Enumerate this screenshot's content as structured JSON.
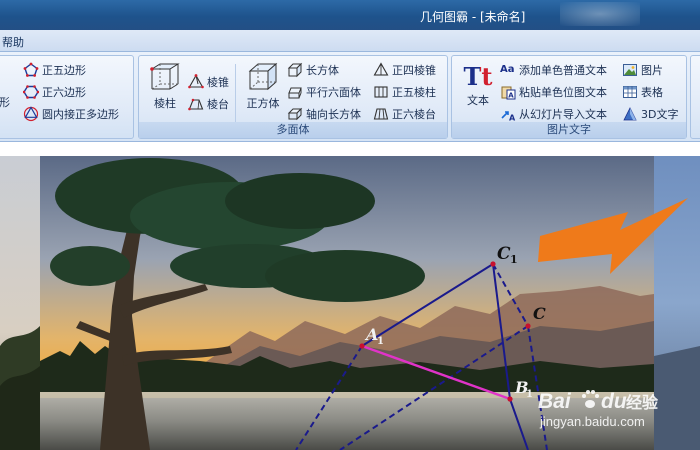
{
  "window": {
    "title": "几何图霸 - [未命名]"
  },
  "menu": {
    "help_label": "帮助"
  },
  "ribbon": {
    "left_group": {
      "partial_label": "形",
      "items": [
        {
          "label": "正五边形",
          "icon": "pentagon-icon"
        },
        {
          "label": "正六边形",
          "icon": "hexagon-icon"
        },
        {
          "label": "圆内接正多边形",
          "icon": "inscribed-polygon-icon"
        }
      ]
    },
    "polyhedron_group": {
      "label": "多面体",
      "prism": {
        "label": "棱柱",
        "icon": "prism-icon"
      },
      "pyramid": {
        "label": "棱锥",
        "icon": "pyramid-icon"
      },
      "frustum": {
        "label": "棱台",
        "icon": "frustum-icon"
      },
      "cube": {
        "label": "正方体",
        "icon": "cube-icon"
      },
      "col3": [
        {
          "label": "长方体",
          "icon": "cuboid-icon"
        },
        {
          "label": "平行六面体",
          "icon": "parallelepiped-icon"
        },
        {
          "label": "轴向长方体",
          "icon": "axial-cuboid-icon"
        }
      ],
      "col4": [
        {
          "label": "正四棱锥",
          "icon": "square-pyramid-icon"
        },
        {
          "label": "正五棱柱",
          "icon": "pentagonal-prism-icon"
        },
        {
          "label": "正六棱台",
          "icon": "hexagonal-frustum-icon"
        }
      ]
    },
    "picture_text_group": {
      "label": "图片文字",
      "text": {
        "label": "文本",
        "glyph": "Tt",
        "icon": "text-tt-icon"
      },
      "col2": [
        {
          "label": "添加单色普通文本",
          "glyph": "Aa",
          "icon": "plain-text-icon"
        },
        {
          "label": "粘贴单色位图文本",
          "icon": "paste-bitmap-text-icon"
        },
        {
          "label": "从幻灯片导入文本",
          "icon": "import-slide-text-icon"
        }
      ],
      "col3": [
        {
          "label": "图片",
          "icon": "picture-icon"
        },
        {
          "label": "表格",
          "icon": "table-icon"
        },
        {
          "label": "3D文字",
          "icon": "3d-text-icon"
        }
      ]
    }
  },
  "content": {
    "geometry_labels": {
      "c1": "C",
      "c1_sub": "1",
      "c": "C",
      "a1": "A",
      "a1_sub": "1",
      "b1": "B",
      "b1_sub": "1"
    },
    "watermark": {
      "brand": "Bai",
      "brand_cn": "经验",
      "brand_end": "du",
      "url": "jingyan.baidu.com"
    },
    "colors": {
      "edge": "#1a1a8c",
      "segment": "#e033c8",
      "arrow": "#ef7a1a",
      "vertex": "#c8102e"
    }
  }
}
